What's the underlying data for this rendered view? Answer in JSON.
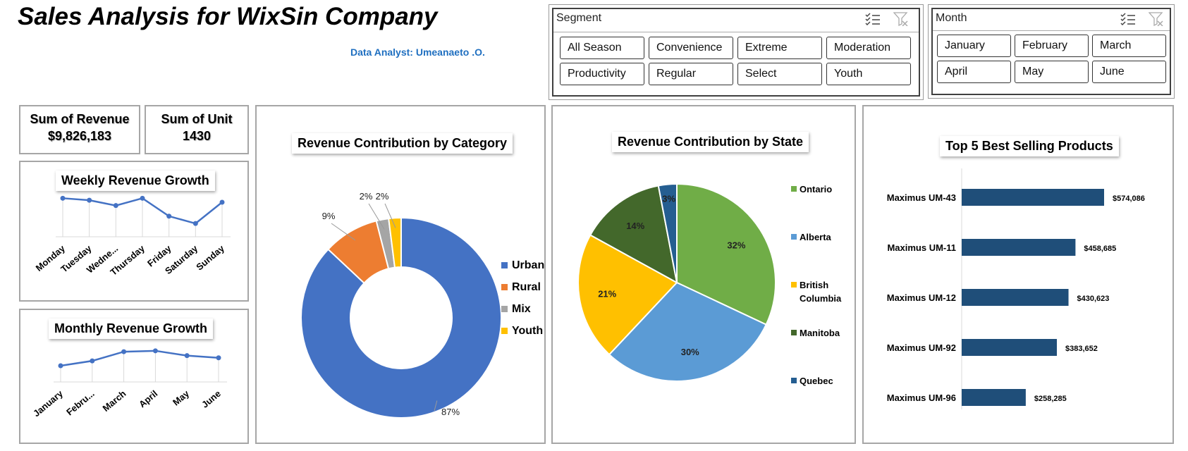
{
  "header": {
    "title": "Sales Analysis for WixSin Company",
    "analyst": "Data Analyst: Umeanaeto .O."
  },
  "slicers": {
    "segment": {
      "header": "Segment",
      "items": [
        "All Season",
        "Convenience",
        "Extreme",
        "Moderation",
        "Productivity",
        "Regular",
        "Select",
        "Youth"
      ],
      "icons": [
        "multi-select-icon",
        "clear-filter-icon"
      ]
    },
    "month": {
      "header": "Month",
      "items": [
        "January",
        "February",
        "March",
        "April",
        "May",
        "June"
      ],
      "icons": [
        "multi-select-icon",
        "clear-filter-icon"
      ]
    }
  },
  "kpis": {
    "revenue_label": "Sum of Revenue",
    "revenue_value": "$9,826,183",
    "unit_label": "Sum of Unit",
    "unit_value": "1430"
  },
  "colors": {
    "line": "#4472c4",
    "urban": "#4472c4",
    "rural": "#ed7d31",
    "mix": "#a5a5a5",
    "youth": "#ffc000",
    "ontario": "#70ad47",
    "alberta": "#5b9bd5",
    "british_columbia": "#ffc000",
    "manitoba": "#43682b",
    "quebec": "#255e91",
    "bar": "#1f4e79"
  },
  "chart_data": [
    {
      "id": "weekly",
      "type": "line",
      "title": "Weekly Revenue Growth",
      "categories": [
        "Monday",
        "Tuesday",
        "Wedne...",
        "Thursday",
        "Friday",
        "Saturday",
        "Sunday"
      ],
      "values": [
        1480000,
        1450000,
        1370000,
        1480000,
        1210000,
        1100000,
        1420000
      ],
      "ylim": [
        900000,
        1600000
      ]
    },
    {
      "id": "monthly",
      "type": "line",
      "title": "Monthly Revenue Growth",
      "categories": [
        "January",
        "Febru...",
        "March",
        "April",
        "May",
        "June"
      ],
      "values": [
        1370000,
        1480000,
        1690000,
        1710000,
        1600000,
        1550000
      ],
      "ylim": [
        1000000,
        1900000
      ]
    },
    {
      "id": "category",
      "type": "pie",
      "donut": true,
      "title": "Revenue Contribution by Category",
      "categories": [
        "Urban",
        "Rural",
        "Mix",
        "Youth"
      ],
      "values": [
        87,
        9,
        2,
        2
      ],
      "labels": [
        "87%",
        "9%",
        "2%",
        "2%"
      ],
      "legend": "right"
    },
    {
      "id": "state",
      "type": "pie",
      "title": "Revenue Contribution by State",
      "categories": [
        "Ontario",
        "Alberta",
        "British Columbia",
        "Manitoba",
        "Quebec"
      ],
      "values": [
        32,
        30,
        21,
        14,
        3
      ],
      "labels": [
        "32%",
        "30%",
        "21%",
        "14%",
        "3%"
      ],
      "legend": "right"
    },
    {
      "id": "top5",
      "type": "bar",
      "orientation": "horizontal",
      "title": "Top 5 Best Selling Products",
      "categories": [
        "Maximus UM-43",
        "Maximus UM-11",
        "Maximus UM-12",
        "Maximus UM-92",
        "Maximus UM-96"
      ],
      "values": [
        574086,
        458685,
        430623,
        383652,
        258285
      ],
      "labels": [
        "$574,086",
        "$458,685",
        "$430,623",
        "$383,652",
        "$258,285"
      ]
    }
  ]
}
